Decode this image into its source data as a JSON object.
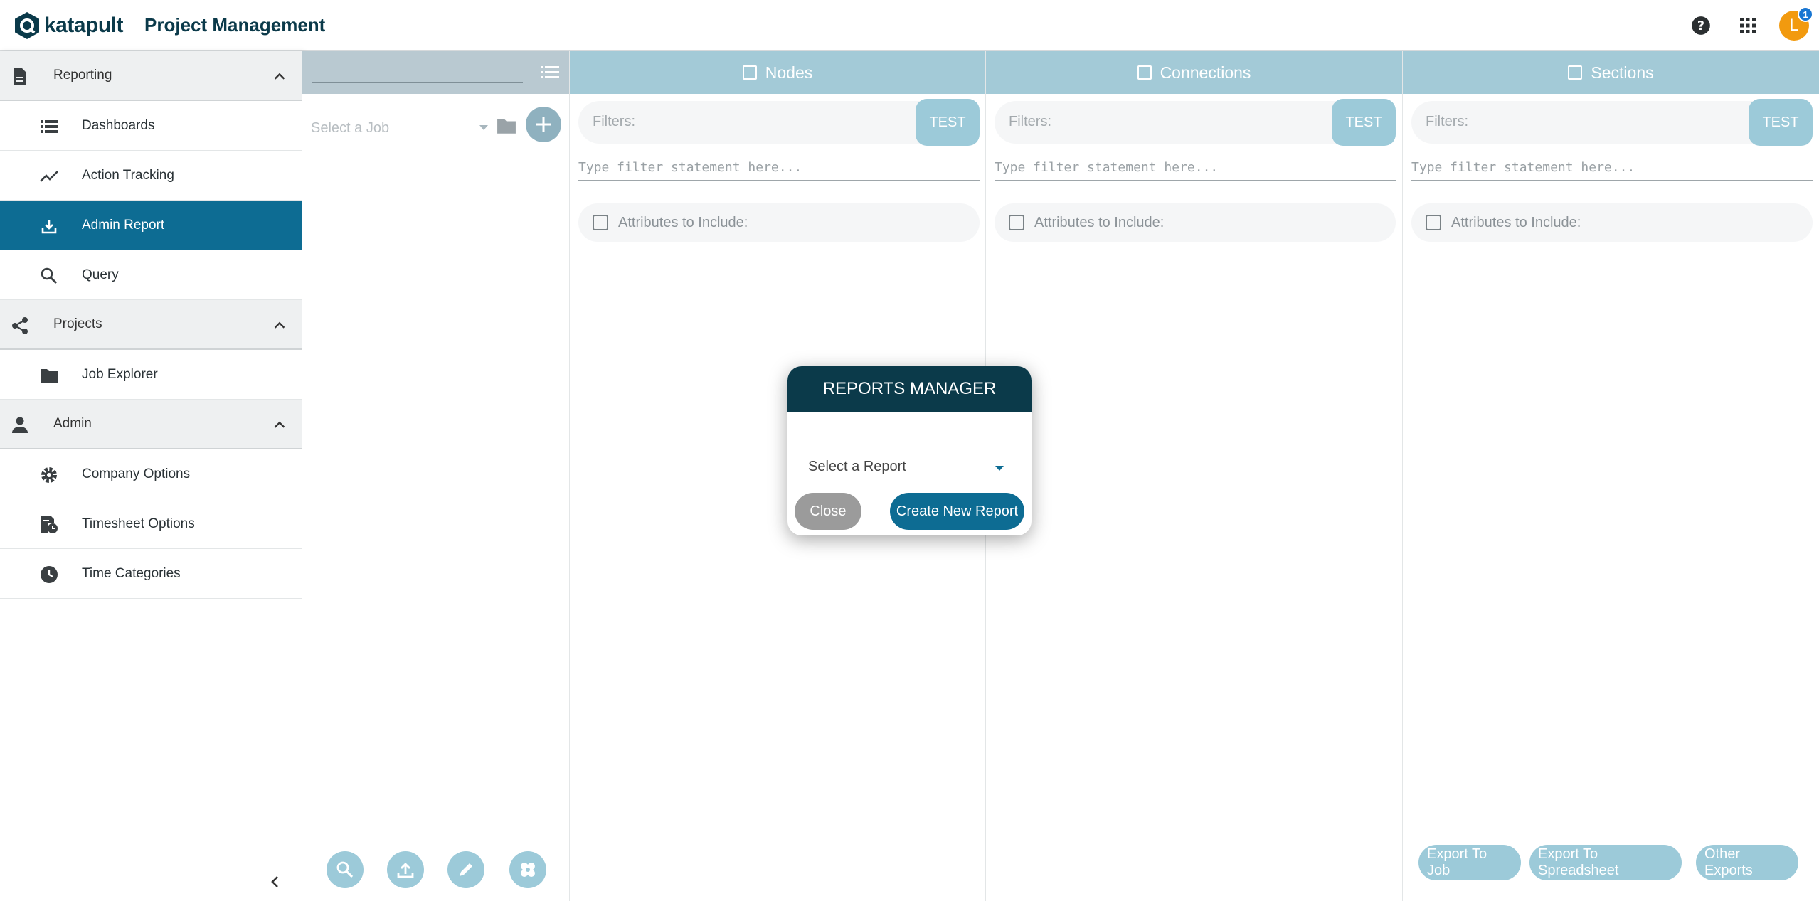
{
  "header": {
    "logo_text": "katapult",
    "app_title": "Project Management",
    "avatar_initial": "L",
    "notification_count": "1",
    "icons": [
      "help-icon",
      "apps-grid-icon"
    ]
  },
  "sidebar": {
    "sections": [
      {
        "label": "Reporting",
        "icon": "document-icon",
        "items": [
          {
            "label": "Dashboards",
            "icon": "list-icon",
            "active": false
          },
          {
            "label": "Action Tracking",
            "icon": "trend-line-icon",
            "active": false
          },
          {
            "label": "Admin Report",
            "icon": "download-icon",
            "active": true
          },
          {
            "label": "Query",
            "icon": "search-icon",
            "active": false
          }
        ]
      },
      {
        "label": "Projects",
        "icon": "share-icon",
        "items": [
          {
            "label": "Job Explorer",
            "icon": "folder-icon",
            "active": false
          }
        ]
      },
      {
        "label": "Admin",
        "icon": "person-icon",
        "items": [
          {
            "label": "Company Options",
            "icon": "gear-icon",
            "active": false
          },
          {
            "label": "Timesheet Options",
            "icon": "timesheet-icon",
            "active": false
          },
          {
            "label": "Time Categories",
            "icon": "clock-icon",
            "active": false
          }
        ]
      }
    ]
  },
  "job_column": {
    "search_value": "",
    "job_select_placeholder": "Select a Job"
  },
  "panels": [
    {
      "title": "Nodes",
      "filter_label": "Filters:",
      "test_label": "TEST",
      "filter_placeholder": "Type filter statement here...",
      "attributes_label": "Attributes to Include:"
    },
    {
      "title": "Connections",
      "filter_label": "Filters:",
      "test_label": "TEST",
      "filter_placeholder": "Type filter statement here...",
      "attributes_label": "Attributes to Include:"
    },
    {
      "title": "Sections",
      "filter_label": "Filters:",
      "test_label": "TEST",
      "filter_placeholder": "Type filter statement here...",
      "attributes_label": "Attributes to Include:"
    }
  ],
  "exports": {
    "to_job": "Export To Job",
    "to_spreadsheet": "Export To Spreadsheet",
    "other": "Other Exports"
  },
  "modal": {
    "title": "REPORTS MANAGER",
    "select_placeholder": "Select a Report",
    "close_label": "Close",
    "create_label": "Create New Report"
  },
  "colors": {
    "brand_dark": "#0b3a4a",
    "active": "#0d6c93",
    "panel_header": "#a3cad7",
    "button_light": "#9ccad9",
    "avatar": "#f29a0f"
  }
}
